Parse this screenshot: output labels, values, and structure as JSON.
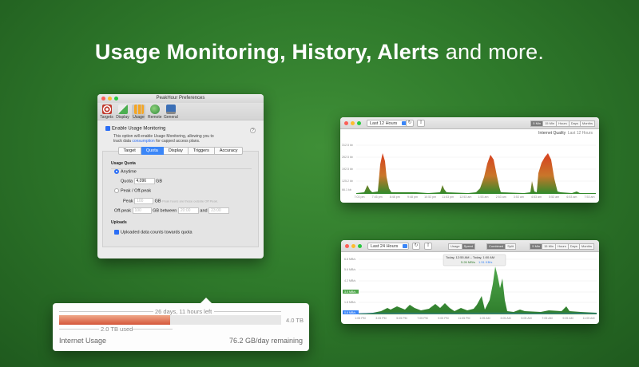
{
  "headline": {
    "bold": "Usage Monitoring, History, Alerts",
    "rest": " and more."
  },
  "prefs": {
    "title": "PeakHour Preferences",
    "toolbar": [
      {
        "label": "Targets",
        "icon": "target-icon",
        "color": "#c0392b"
      },
      {
        "label": "Display",
        "icon": "chart-icon",
        "color": "#4caf50"
      },
      {
        "label": "Usage",
        "icon": "bars-icon",
        "color": "#f5a623"
      },
      {
        "label": "Remote",
        "icon": "globe-icon",
        "color": "#3aa757"
      },
      {
        "label": "General",
        "icon": "monitor-icon",
        "color": "#3b6fb6"
      }
    ],
    "enable_label": "Enable Usage Monitoring",
    "desc_line1": "This option will enable Usage Monitoring, allowing you to",
    "desc_line2_a": "track data ",
    "desc_link": "consumption",
    "desc_line2_b": " for capped access plans.",
    "tabs": [
      "Target",
      "Quota",
      "Display",
      "Triggers",
      "Accuracy"
    ],
    "selected_tab": "Quota",
    "usage_quota_title": "Usage Quota",
    "anytime": "Anytime",
    "quota_label": "Quota",
    "quota_value": "4,096",
    "quota_unit": "GB",
    "peak_offpeak": "Peak / Off-peak",
    "peak_label": "Peak",
    "peak_placeholder": "100",
    "peak_unit": "GB",
    "peak_note": "Peak hours are those outside Off Peak.",
    "offpeak_label": "Off-peak",
    "offpeak_placeholder": "100",
    "between_label": "GB between",
    "from_time": "20:00",
    "and_label": "and",
    "to_time": "23:00",
    "uploads_title": "Uploads",
    "uploads_label": "Uploaded data counts towards quota"
  },
  "window1": {
    "range": "Last 12 Hours",
    "segments": [
      "5 Min",
      "15 Min",
      "Hours",
      "Days",
      "Months"
    ],
    "legend_name": "Internet Quality",
    "legend_range": "Last 12 Hours",
    "y_ticks": [
      "312.5 kb",
      "262.5 kb",
      "192.5 kb",
      "125.2 kb",
      "66.1 kb"
    ],
    "x_ticks": [
      "7:03 pm",
      "7:45 pm",
      "8:48 pm",
      "9:48 pm",
      "10:53 pm",
      "11:53 pm",
      "12:53 am",
      "1:53 am",
      "2:53 am",
      "3:53 am",
      "4:53 am",
      "5:53 am",
      "6:53 am",
      "7:53 am"
    ]
  },
  "window2": {
    "range": "Last 24 Hours",
    "toggle": [
      "Usage",
      "Speed"
    ],
    "seg_a": [
      "Combined",
      "Split"
    ],
    "segments": [
      "5 Min",
      "15 Min",
      "Hours",
      "Days",
      "Months"
    ],
    "tooltip_line1": "Today, 12:55 AM – Today, 1:00 AM",
    "tooltip_down": "5.26 MB/s",
    "tooltip_up": "1.51 KB/s",
    "y_ticks": [
      "6.8 MB/s",
      "5.6 MB/s",
      "4.2 MB/s",
      "3.0 MB/s",
      "1.8 MB/s",
      "0.6 MB/s"
    ],
    "x_ticks": [
      "1:05 PM",
      "3:05 PM",
      "5:05 PM",
      "7:05 PM",
      "9:05 PM",
      "11:05 PM",
      "1:05 AM",
      "3:05 AM",
      "5:05 AM",
      "7:05 AM",
      "9:05 AM",
      "11:05 AM"
    ]
  },
  "widget": {
    "days_left": "26 days, 11 hours left",
    "total": "4.0 TB",
    "used": "2.0 TB used",
    "progress_fraction": 0.5,
    "title": "Internet Usage",
    "rate": "76.2 GB/day remaining"
  }
}
